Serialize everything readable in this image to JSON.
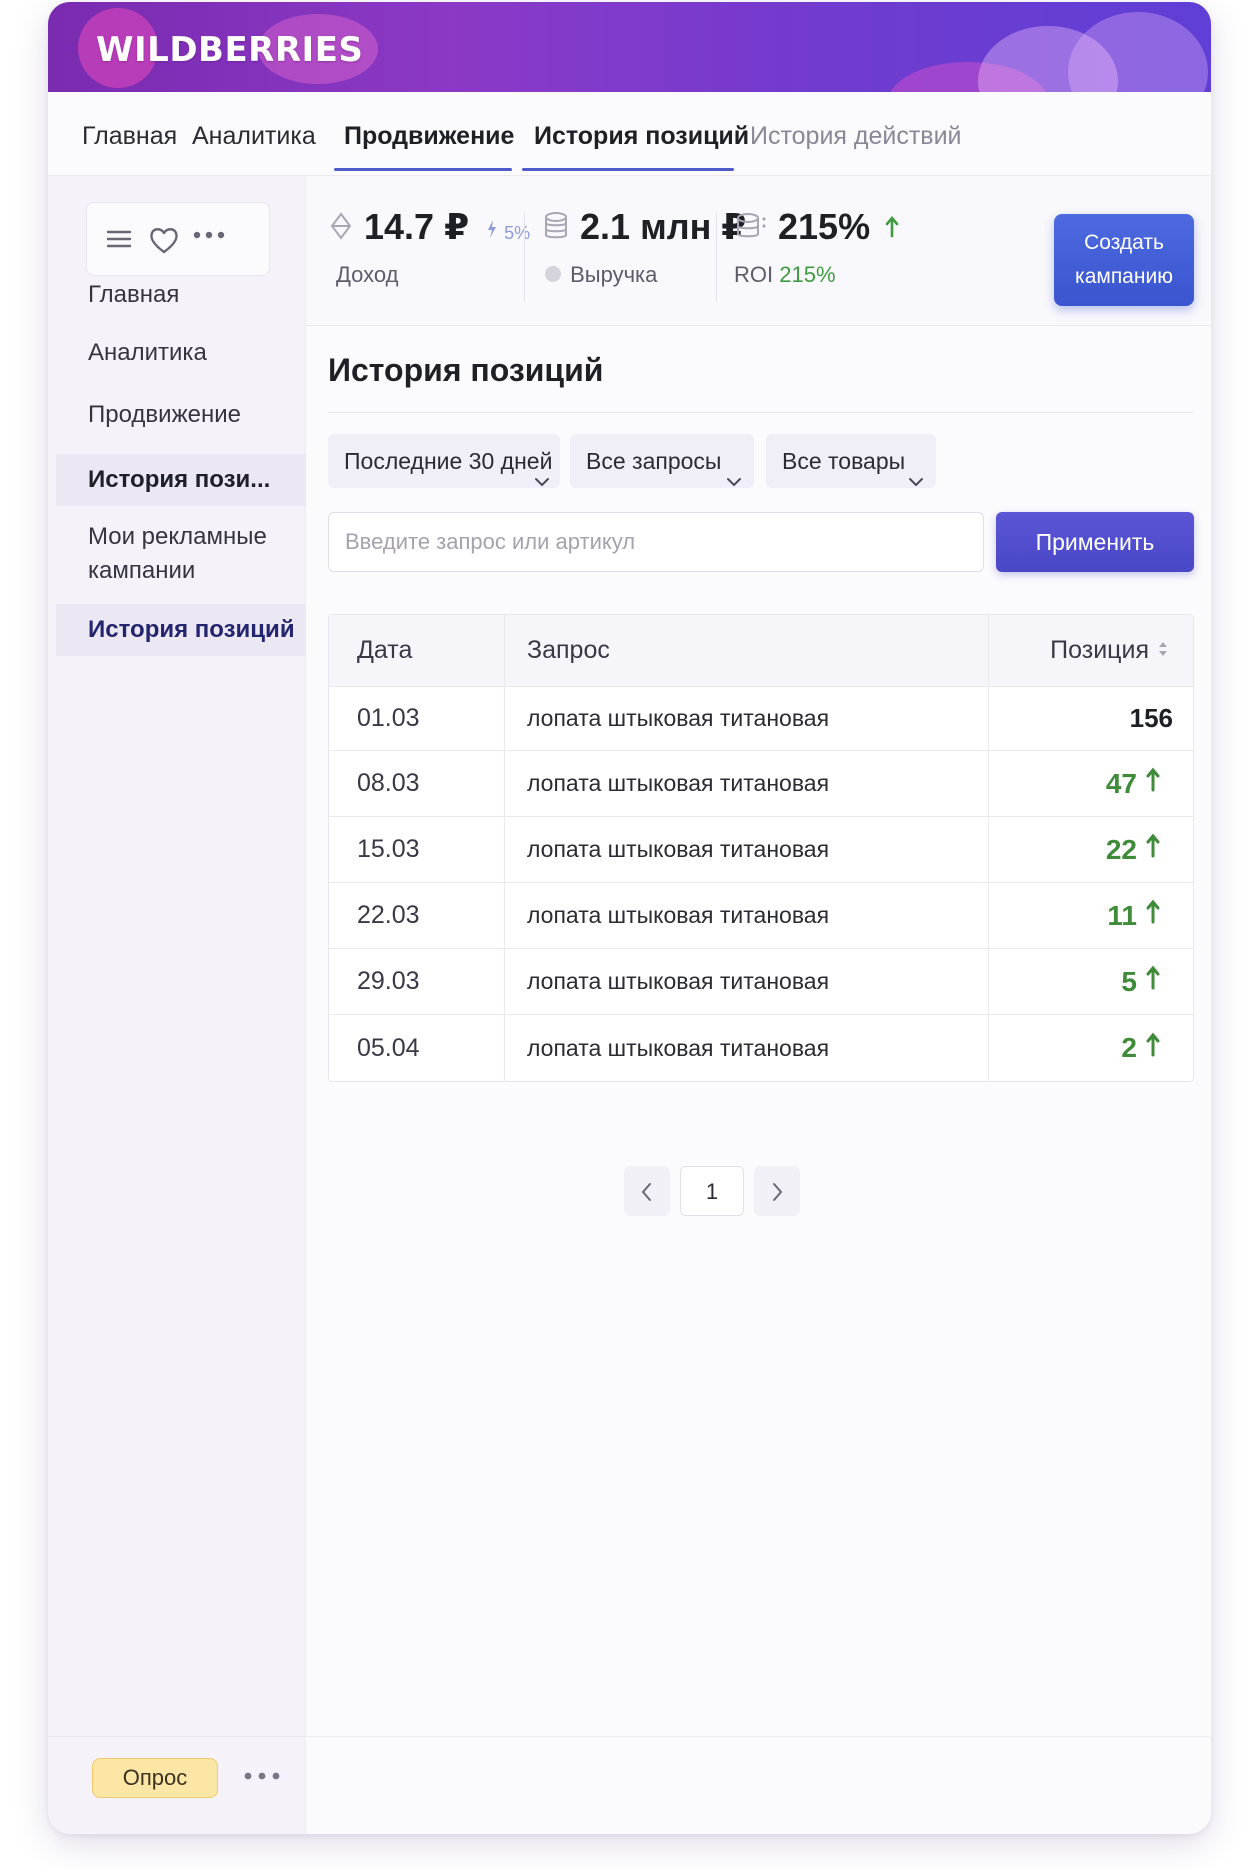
{
  "brand": {
    "logo": "WILDBERRIES"
  },
  "topnav": {
    "tabs": [
      {
        "label": "Главная"
      },
      {
        "label": "Аналитика"
      },
      {
        "label": "Продвижение"
      },
      {
        "label": "История позиций"
      },
      {
        "label": "История действий"
      }
    ]
  },
  "sidebar": {
    "items": [
      {
        "label": "Главная"
      },
      {
        "label": "Аналитика"
      },
      {
        "label": "Продвижение"
      },
      {
        "label": "История пози..."
      },
      {
        "label": "Мои рекламные"
      },
      {
        "label": "кампании"
      },
      {
        "label": "История позиций"
      }
    ],
    "survey_label": "Опрос"
  },
  "kpis": {
    "income": {
      "value": "14.7 ₽",
      "change": "5%",
      "label": "Доход"
    },
    "revenue": {
      "value": "2.1 млн ₽",
      "label": "Выручка"
    },
    "roi": {
      "value": "215%",
      "label_prefix": "ROI",
      "label_value": "215%"
    },
    "cta_line1": "Создать",
    "cta_line2": "кампанию"
  },
  "page": {
    "title": "История позиций",
    "filters": {
      "period": "Последние 30 дней",
      "queries": "Все запросы",
      "products": "Все товары"
    },
    "search_placeholder": "Введите запрос или артикул",
    "apply_label": "Применить"
  },
  "table": {
    "headers": {
      "date": "Дата",
      "query": "Запрос",
      "position": "Позиция"
    },
    "rows": [
      {
        "date": "01.03",
        "query": "лопата штыковая титановая",
        "position": "156",
        "trend": "none"
      },
      {
        "date": "08.03",
        "query": "лопата штыковая титановая",
        "position": "47",
        "trend": "up"
      },
      {
        "date": "15.03",
        "query": "лопата штыковая титановая",
        "position": "22",
        "trend": "up"
      },
      {
        "date": "22.03",
        "query": "лопата штыковая титановая",
        "position": "11",
        "trend": "up"
      },
      {
        "date": "29.03",
        "query": "лопата штыковая титановая",
        "position": "5",
        "trend": "up"
      },
      {
        "date": "05.04",
        "query": "лопата штыковая титановая",
        "position": "2",
        "trend": "up"
      }
    ]
  },
  "pagination": {
    "current": "1"
  },
  "colors": {
    "brand_purple": "#8b39c6",
    "accent_blue": "#3a55cf",
    "apply_violet": "#4a47c6",
    "positive_green": "#3f8b3a",
    "survey_yellow": "#fbe6a6"
  },
  "icons": [
    "menu-icon",
    "heart-icon",
    "more-icon",
    "income-icon",
    "trend-icon",
    "coins-icon",
    "info-icon",
    "stack-icon",
    "arrow-up-icon",
    "chevron-down-icon",
    "sort-icon",
    "chevron-left-icon",
    "chevron-right-icon"
  ]
}
